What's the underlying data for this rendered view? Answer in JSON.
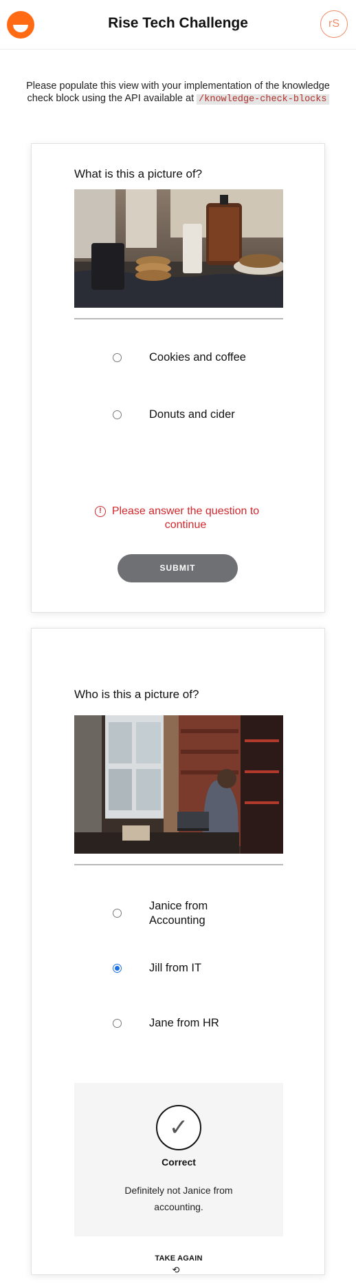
{
  "header": {
    "title": "Rise Tech Challenge",
    "avatar_initials": "rS",
    "logo_icon": "rise-logo-icon"
  },
  "intro": {
    "text": "Please populate this view with your implementation of the knowledge check block using the API available at",
    "code": "/knowledge-check-blocks"
  },
  "blocks": [
    {
      "question": "What is this a picture of?",
      "image_subject": "cookies and coffee on a table",
      "options": [
        {
          "label": "Cookies and coffee",
          "selected": false
        },
        {
          "label": "Donuts and cider",
          "selected": false
        }
      ],
      "error": "Please answer the question to continue",
      "submit_label": "SUBMIT"
    },
    {
      "question": "Who is this a picture of?",
      "image_subject": "woman working on a laptop in a cafe",
      "options": [
        {
          "label": "Janice from Accounting",
          "selected": false
        },
        {
          "label": "Jill from IT",
          "selected": true
        },
        {
          "label": "Jane from HR",
          "selected": false
        }
      ],
      "result": {
        "title": "Correct",
        "feedback": "Definitely not Janice from accounting."
      },
      "take_again_label": "TAKE AGAIN"
    }
  ],
  "colors": {
    "brand": "#ff6a13",
    "error": "#d2262b",
    "selected": "#1c6fe0",
    "button": "#6e7073"
  }
}
